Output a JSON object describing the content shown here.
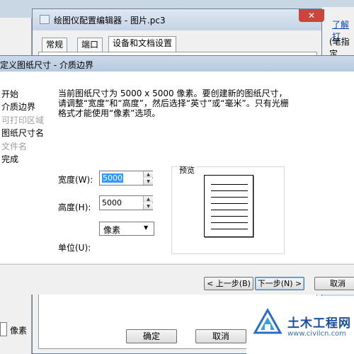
{
  "background_window": {
    "title": "绘图仪配置编辑器 - 图片.pc3",
    "close_glyph": "✕",
    "tabs": [
      "常规",
      "端口",
      "设备和文档设置"
    ],
    "ok_label": "确定",
    "cancel_label": "取消"
  },
  "left_window": {
    "pixel_label": "像素"
  },
  "right_window": {
    "link_text": "了解打",
    "text": "(笔指定"
  },
  "dialog": {
    "title": "定义图纸尺寸 - 介质边界",
    "steps": [
      {
        "label": "开始",
        "enabled": true
      },
      {
        "label": "介质边界",
        "enabled": true
      },
      {
        "label": "可打印区域",
        "enabled": false
      },
      {
        "label": "图纸尺寸名",
        "enabled": true
      },
      {
        "label": "文件名",
        "enabled": false
      },
      {
        "label": "完成",
        "enabled": true
      }
    ],
    "instruction": "当前图纸尺寸为 5000 x 5000 像素。要创建新的图纸尺寸，请调整“宽度”和“高度”，然后选择“英寸”或“毫米”。只有光栅格式才能使用“像素”选项。",
    "width_label": "宽度(W):",
    "width_value": "5000",
    "height_label": "高度(H):",
    "height_value": "5000",
    "unit_label": "单位(U):",
    "unit_value": "像素",
    "preview_label": "预览",
    "back_label": "< 上一步(B)",
    "next_label": "下一步(N) >",
    "cancel_label": "取消"
  },
  "watermark": {
    "title": "土木工程网",
    "url": "www.civilcn.com"
  },
  "colors": {
    "selection": "#3399ff",
    "watermark_blue": "#1b4fa0"
  }
}
